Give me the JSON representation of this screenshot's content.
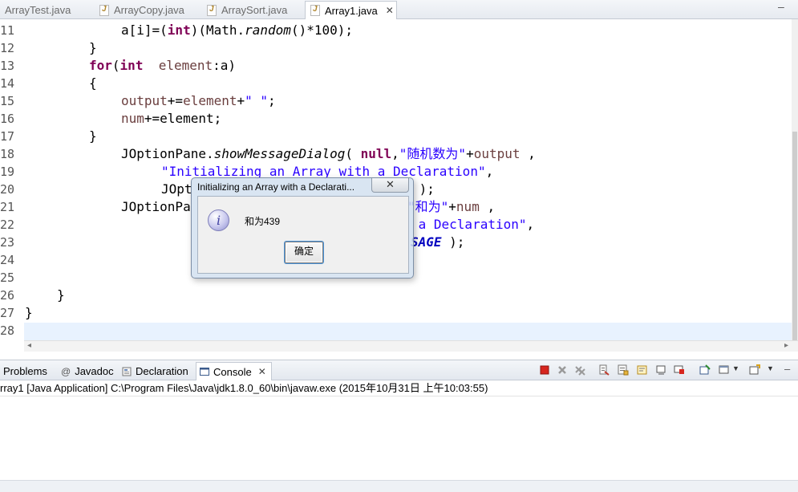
{
  "editor": {
    "tabs": [
      {
        "label": "ArrayTest.java",
        "active": false
      },
      {
        "label": "ArrayCopy.java",
        "active": false
      },
      {
        "label": "ArraySort.java",
        "active": false
      },
      {
        "label": "Array1.java",
        "active": true
      }
    ],
    "tab_close": "✕",
    "minimize": "–",
    "line_numbers": [
      "11",
      "12",
      "13",
      "14",
      "15",
      "16",
      "17",
      "18",
      "19",
      "20",
      "21",
      "22",
      "23",
      "24",
      "25",
      "26",
      "27",
      "28"
    ],
    "code": {
      "l11_a": "a[i]=(",
      "l11_kw": "int",
      "l11_b": ")(Math.",
      "l11_m": "random",
      "l11_c": "()*100);",
      "l12": "}",
      "l13_kw1": "for",
      "l13_a": "(",
      "l13_kw2": "int",
      "l13_b": "  ",
      "l13_f": "element",
      "l13_c": ":a)",
      "l14": "{",
      "l15_f1": "output",
      "l15_a": "+=",
      "l15_f2": "element",
      "l15_b": "+",
      "l15_s": "\" \"",
      "l15_c": ";",
      "l16_f": "num",
      "l16_a": "+=element;",
      "l17": "}",
      "l18_a": "JOptionPane.",
      "l18_m": "showMessageDialog",
      "l18_b": "( ",
      "l18_kw": "null",
      "l18_c": ",",
      "l18_s": "\"随机数为\"",
      "l18_d": "+",
      "l18_f": "output",
      "l18_e": " ,",
      "l19_s": "\"Initializing an Array with a Declaration\"",
      "l19_a": ",",
      "l20_a": "JOpt",
      "l20_b": " );",
      "l21_a": "JOptionPa",
      "l21_s": "\"和为\"",
      "l21_b": "+",
      "l21_f": "num",
      "l21_c": " ,",
      "l22_s": " a Declaration\"",
      "l22_a": ",",
      "l23_c": "SAGE",
      "l23_a": " );",
      "l26": "}",
      "l27": "}"
    }
  },
  "panel": {
    "tabs": [
      {
        "label": "Problems",
        "icon": "problems-icon"
      },
      {
        "label": "Javadoc",
        "icon": "javadoc-icon"
      },
      {
        "label": "Declaration",
        "icon": "declaration-icon"
      },
      {
        "label": "Console",
        "icon": "console-icon",
        "active": true
      }
    ],
    "tab_close": "✕",
    "console_header": "rray1 [Java Application] C:\\Program Files\\Java\\jdk1.8.0_60\\bin\\javaw.exe (2015年10月31日 上午10:03:55)"
  },
  "dialog": {
    "title": "Initializing an Array with a Declarati...",
    "close": "✕",
    "icon_glyph": "i",
    "message": "和为439",
    "ok_label": "确定"
  },
  "colors": {
    "keyword": "#7f0055",
    "field": "#6a3e3e",
    "string": "#2a00ff",
    "constant": "#0000c0",
    "terminate": "#d7261f"
  }
}
